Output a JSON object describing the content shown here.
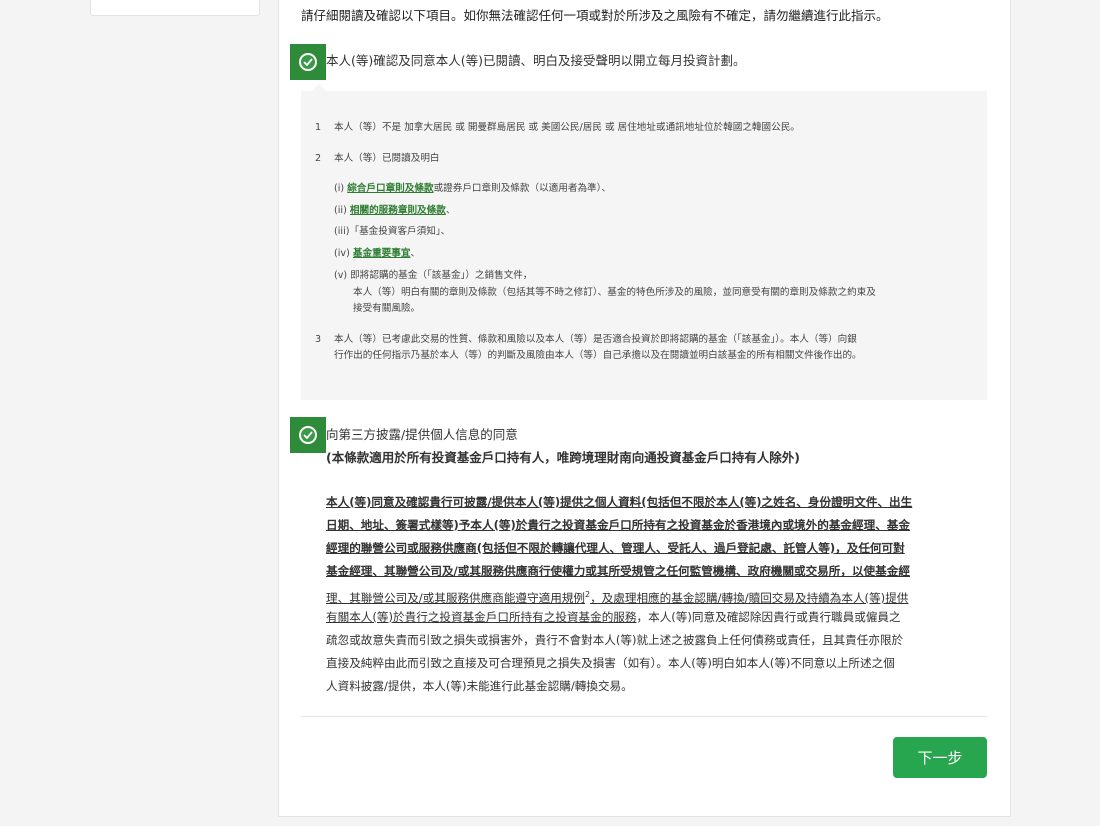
{
  "intro_text": "請仔細閱讀及確認以下項目。如你無法確認任何一項或對於所涉及之風險有不確定，請勿繼續進行此指示。",
  "confirm1_label": "本人(等)確認及同意本人(等)已閱讀、明白及接受聲明以開立每月投資計劃。",
  "terms": {
    "item1_num": "1",
    "item1_text": "本人（等）不是 加拿大居民 或 開曼群島居民 或 美國公民/居民 或 居住地址或通訊地址位於韓國之韓國公民。",
    "item2_num": "2",
    "item2_text": "本人（等）已閱讀及明白",
    "sub_i_prefix": "(i)",
    "sub_i_link": "綜合戶口章則及條款",
    "sub_i_rest": "或證券戶口章則及條款（以適用者為準）、",
    "sub_ii_prefix": "(ii)",
    "sub_ii_link": "相關的服務章則及條款",
    "sub_ii_rest": "、",
    "sub_iii_text": "(iii)「基金投資客戶須知」、",
    "sub_iv_prefix": "(iv)",
    "sub_iv_link": "基金重要事宜",
    "sub_iv_rest": "、",
    "sub_v_line1": "(v) 即將認購的基金（「該基金」）之銷售文件，",
    "sub_v_line2": "本人（等）明白有關的章則及條款（包括其等不時之修訂）、基金的特色所涉及的風險，並同意受有關的章則及條款之約束及",
    "sub_v_line3": "接受有關風險。",
    "item3_num": "3",
    "item3_line1": "本人（等）已考慮此交易的性質、條款和風險以及本人（等）是否適合投資於即將認購的基金（「該基金」）。本人（等）向銀",
    "item3_line2": "行作出的任何指示乃基於本人（等）的判斷及風險由本人（等）自己承擔以及在閱讀並明白該基金的所有相關文件後作出的。"
  },
  "consent": {
    "title": "向第三方披露/提供個人信息的同意",
    "subtitle": "(本條款適用於所有投資基金戶口持有人，唯跨境理財南向通投資基金戶口持有人除外)",
    "lines": [
      "本人(等)同意及確認貴行可披露/提供本人(等)提供之個人資料(包括但不限於本人(等)之姓名、身份證明文件、出生",
      "日期、地址、簽署式樣等)予本人(等)於貴行之投資基金戶口所持有之投資基金於香港境內或境外的基金經理、基金",
      "經理的聯營公司或服務供應商(包括但不限於轉讓代理人、管理人、受託人、過戶登記處、託管人等)，及任何可對",
      "基金經理、其聯營公司及/或其服務供應商行使權力或其所受規管之任何監管機構、政府機關或交易所，以使基金經",
      "理、其聯營公司及/或其服務供應商能遵守適用規例",
      "2",
      "，及處理相應的基金認購/轉換/贖回交易及持續為本人(等)提供",
      "有關本人(等)於貴行之投資基金戶口所持有之投資基金的服務",
      "，本人(等)同意及確認除因貴行或貴行職員或僱員之",
      "疏忽或故意失責而引致之損失或損害外，貴行不會對本人(等)就上述之披露負上任何債務或責任，且其責任亦限於",
      "直接及純粹由此而引致之直接及可合理預見之損失及損害（如有）。本人(等)明白如本人(等)不同意以上所述之個",
      "人資料披露/提供，本人(等)未能進行此基金認購/轉換交易。"
    ]
  },
  "next_button_label": "下一步",
  "colors": {
    "accent_green": "#27a64f",
    "checkbox_green": "#2e8b3a",
    "link_green": "#2e7d32"
  }
}
